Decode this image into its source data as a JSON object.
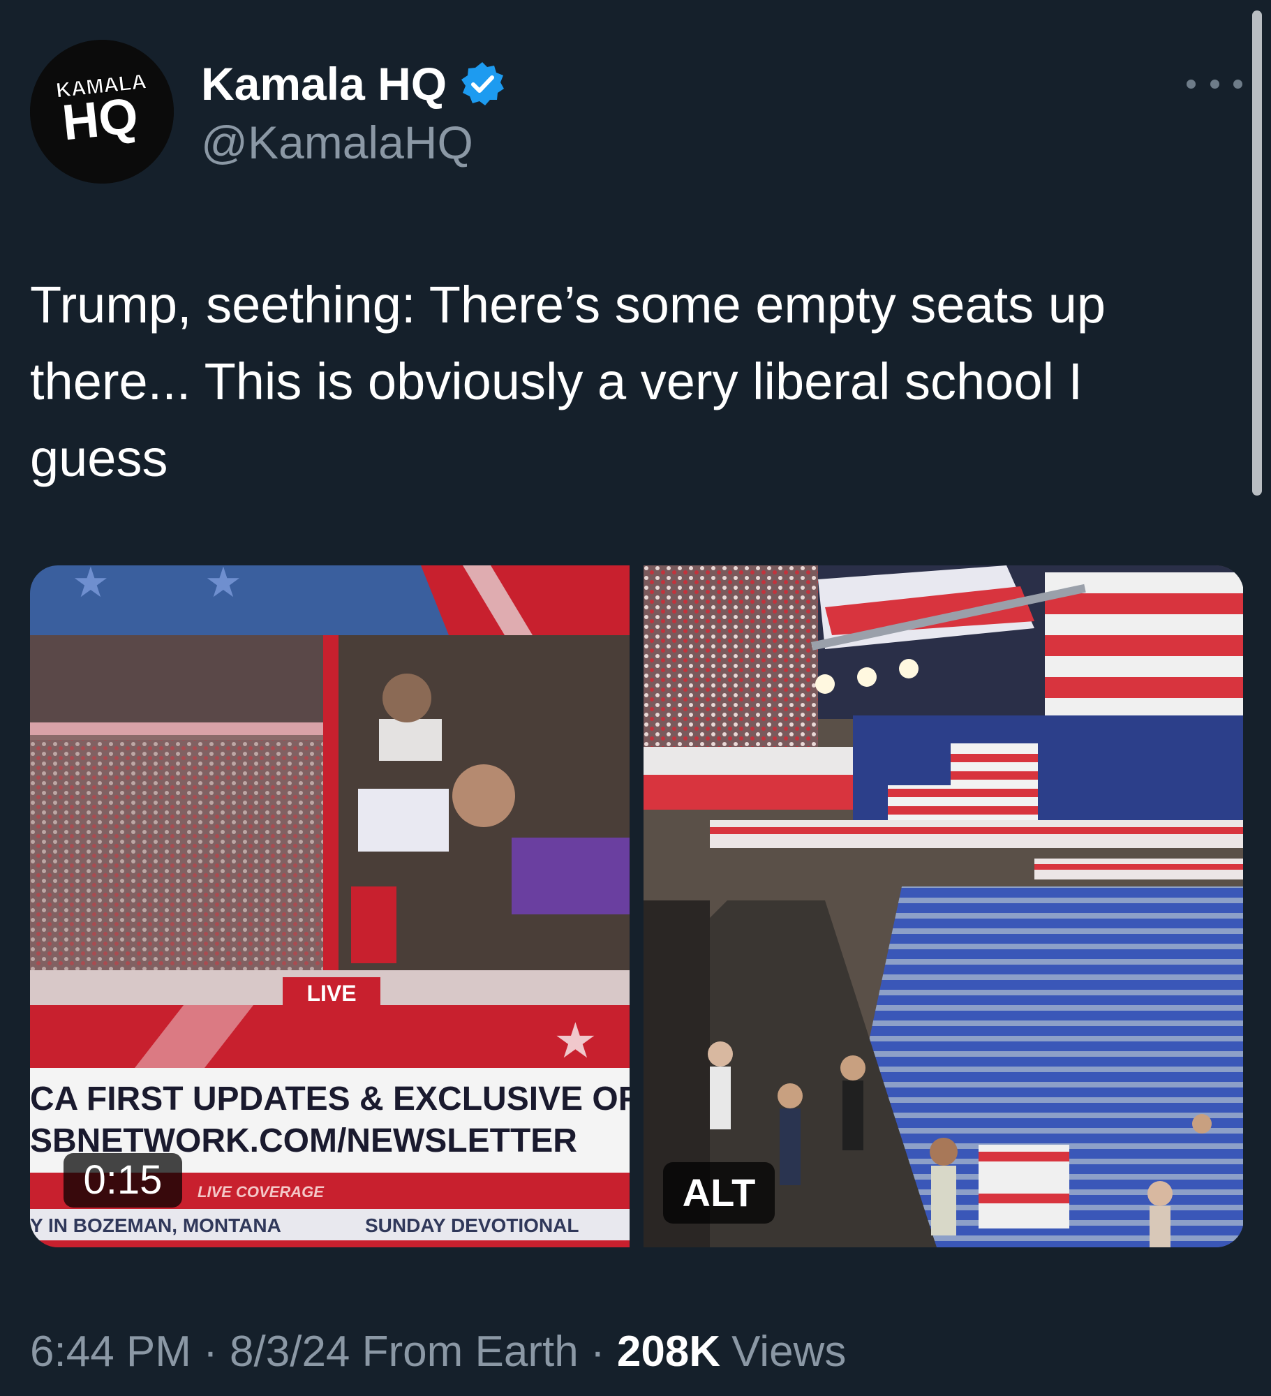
{
  "author": {
    "display_name": "Kamala HQ",
    "handle": "@KamalaHQ",
    "verified": true,
    "avatar": {
      "line1": "KAMALA",
      "line2": "HQ"
    }
  },
  "more_icon": "more-horizontal-icon",
  "tweet_text": "Trump, seething: There’s some empty seats up there... This is obviously a very liberal school I guess",
  "media": {
    "video": {
      "duration": "0:15",
      "overlay": {
        "live_label": "LIVE",
        "ticker_line1": "CA FIRST UPDATES & EXCLUSIVE OFF",
        "ticker_line2": "SBNETWORK.COM/NEWSLETTER",
        "bottom_left": "Y IN BOZEMAN, MONTANA",
        "bottom_right": "SUNDAY DEVOTIONAL",
        "small_tag": "LIVE COVERAGE"
      }
    },
    "photo": {
      "alt_label": "ALT"
    }
  },
  "meta": {
    "time": "6:44 PM",
    "date": "8/3/24",
    "source": "From Earth",
    "separator": "·",
    "views_count": "208K",
    "views_label": "Views"
  },
  "colors": {
    "background": "#15202b",
    "secondary_text": "#8b98a5",
    "verified_blue": "#1d9bf0"
  }
}
